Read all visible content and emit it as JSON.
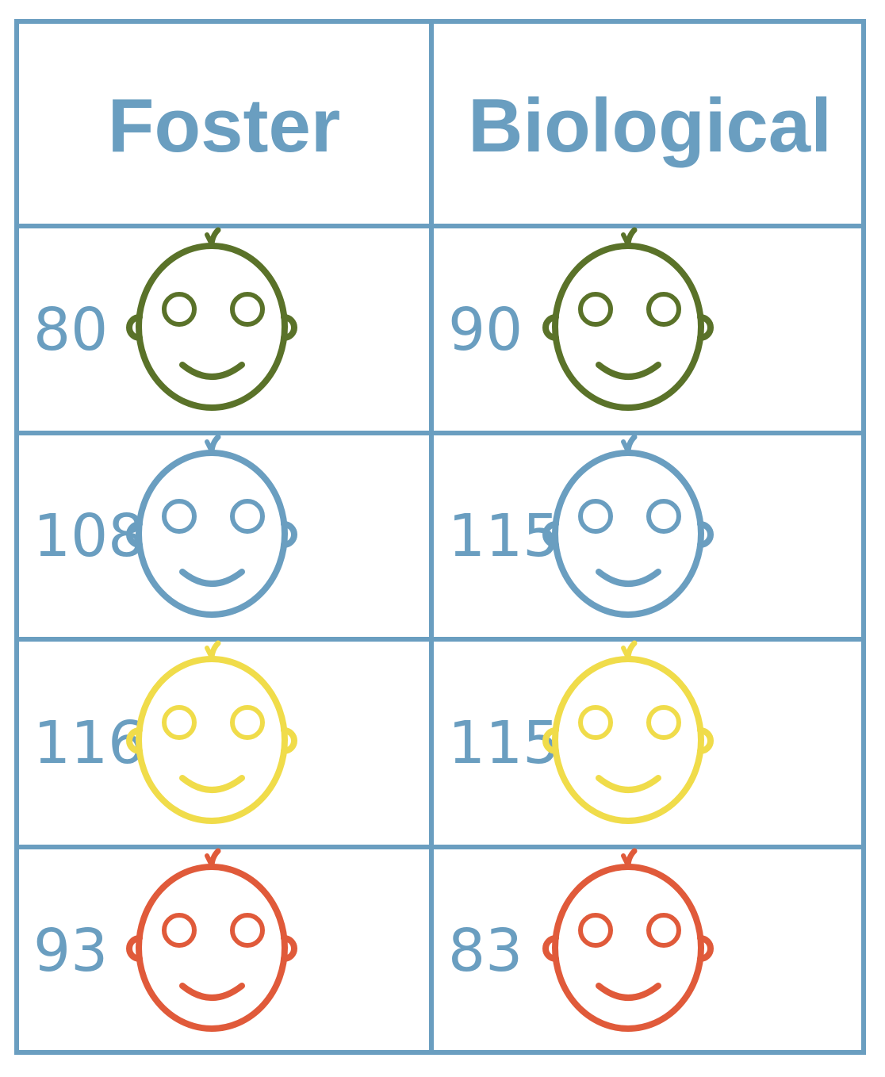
{
  "headers": [
    "Foster",
    "Biological"
  ],
  "rows": [
    {
      "foster": "80",
      "biological": "90",
      "color": "#5a7229"
    },
    {
      "foster": "108",
      "biological": "115",
      "color": "#6a9ec0"
    },
    {
      "foster": "116",
      "biological": "115",
      "color": "#f0dc4a"
    },
    {
      "foster": "93",
      "biological": "83",
      "color": "#e05a3a"
    }
  ],
  "icon": "baby-face-icon",
  "border_color": "#6a9ec0"
}
